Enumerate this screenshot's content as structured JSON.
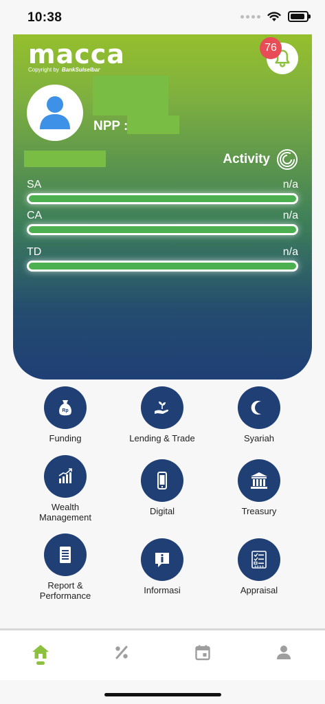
{
  "status_bar": {
    "time": "10:38"
  },
  "header": {
    "logo_text": "macca",
    "logo_copyright": "Copyright by",
    "logo_brand": "BankSulselbar",
    "notification_count": "76",
    "npp_label": "NPP :",
    "activity_label": "Activity"
  },
  "accounts": [
    {
      "label": "SA",
      "value": "n/a",
      "fill_fraction": 1.0
    },
    {
      "label": "CA",
      "value": "n/a",
      "fill_fraction": 1.0
    },
    {
      "label": "TD",
      "value": "n/a",
      "fill_fraction": 1.0
    }
  ],
  "menu": [
    {
      "label": "Funding",
      "icon": "money-bag-icon"
    },
    {
      "label": "Lending & Trade",
      "icon": "hand-plant-icon"
    },
    {
      "label": "Syariah",
      "icon": "crescent-icon"
    },
    {
      "label": "Wealth Management",
      "icon": "bar-chart-icon"
    },
    {
      "label": "Digital",
      "icon": "smartphone-icon"
    },
    {
      "label": "Treasury",
      "icon": "bank-building-icon"
    },
    {
      "label": "Report & Performance",
      "icon": "document-icon"
    },
    {
      "label": "Informasi",
      "icon": "info-bubble-icon"
    },
    {
      "label": "Appraisal",
      "icon": "checklist-icon"
    }
  ],
  "bottom_nav": [
    {
      "name": "home",
      "icon": "home-icon",
      "active": true
    },
    {
      "name": "percent",
      "icon": "percent-icon",
      "active": false
    },
    {
      "name": "calendar",
      "icon": "calendar-icon",
      "active": false
    },
    {
      "name": "profile",
      "icon": "user-icon",
      "active": false
    }
  ],
  "colors": {
    "brand_green": "#8cc13f",
    "brand_navy": "#1f3f75",
    "bar_green": "#4caf50",
    "badge_red": "#e84c56",
    "redaction_green": "#79bd45"
  }
}
